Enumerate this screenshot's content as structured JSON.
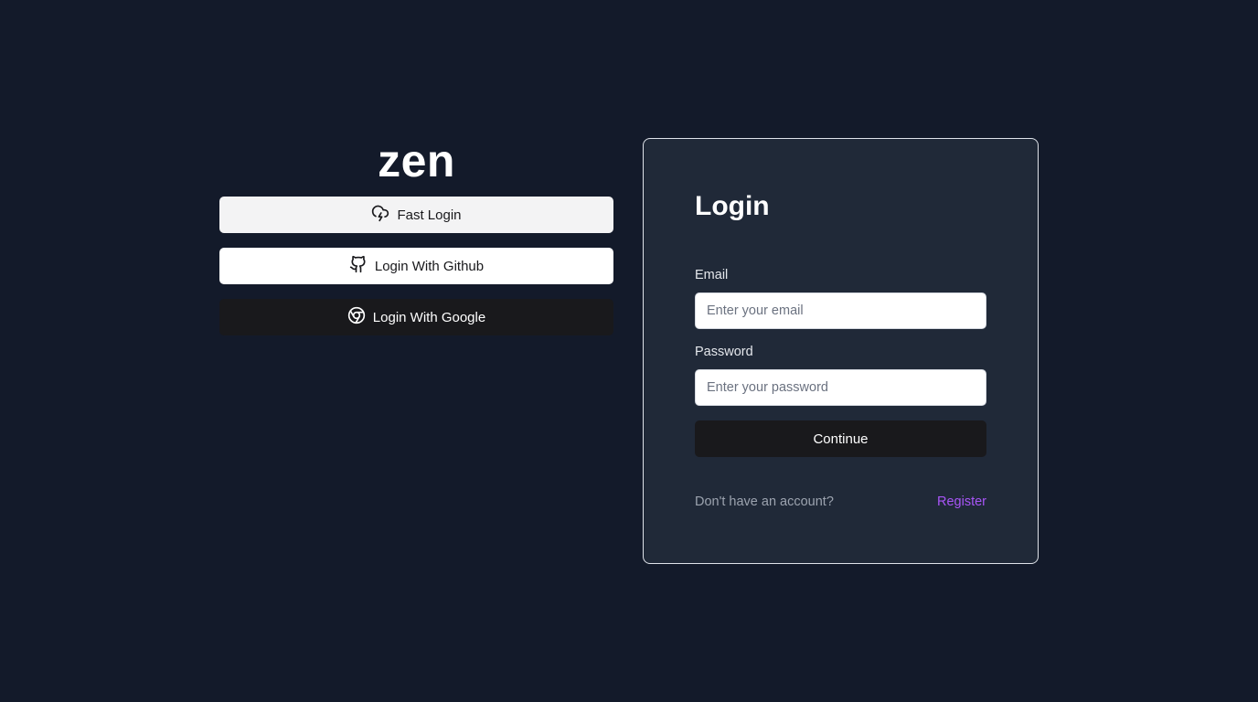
{
  "brand": {
    "name": "zen"
  },
  "oauth": {
    "fast_login": {
      "label": "Fast Login",
      "icon": "cloud-lightning-icon"
    },
    "github": {
      "label": "Login With Github",
      "icon": "github-icon"
    },
    "google": {
      "label": "Login With Google",
      "icon": "chrome-icon"
    }
  },
  "login_card": {
    "title": "Login",
    "email": {
      "label": "Email",
      "value": "",
      "placeholder": "Enter your email"
    },
    "password": {
      "label": "Password",
      "value": "",
      "placeholder": "Enter your password"
    },
    "continue_label": "Continue",
    "no_account_text": "Don't have an account?",
    "register_label": "Register"
  },
  "colors": {
    "background": "#131a2a",
    "card": "#202938",
    "accent": "#a855f7",
    "dark_button": "#19191c"
  }
}
